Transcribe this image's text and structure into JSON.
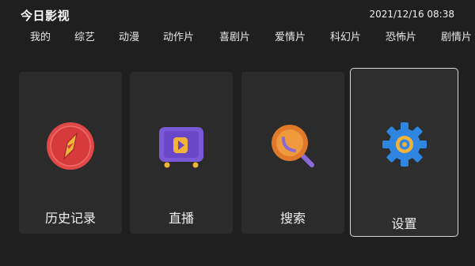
{
  "header": {
    "app_title": "今日影视",
    "datetime": "2021/12/16 08:38"
  },
  "nav": {
    "items": [
      {
        "label": "我的"
      },
      {
        "label": "综艺"
      },
      {
        "label": "动漫"
      },
      {
        "label": "动作片"
      },
      {
        "label": "喜剧片"
      },
      {
        "label": "爱情片"
      },
      {
        "label": "科幻片"
      },
      {
        "label": "恐怖片"
      },
      {
        "label": "剧情片"
      }
    ]
  },
  "cards": [
    {
      "label": "历史记录",
      "icon": "compass-icon",
      "focused": false
    },
    {
      "label": "直播",
      "icon": "tv-play-icon",
      "focused": false
    },
    {
      "label": "搜索",
      "icon": "search-icon",
      "focused": false
    },
    {
      "label": "设置",
      "icon": "gear-icon",
      "focused": true
    }
  ],
  "colors": {
    "background": "#1f1f1f",
    "card": "#2b2b2b",
    "focus_border": "#d9d9d9"
  }
}
